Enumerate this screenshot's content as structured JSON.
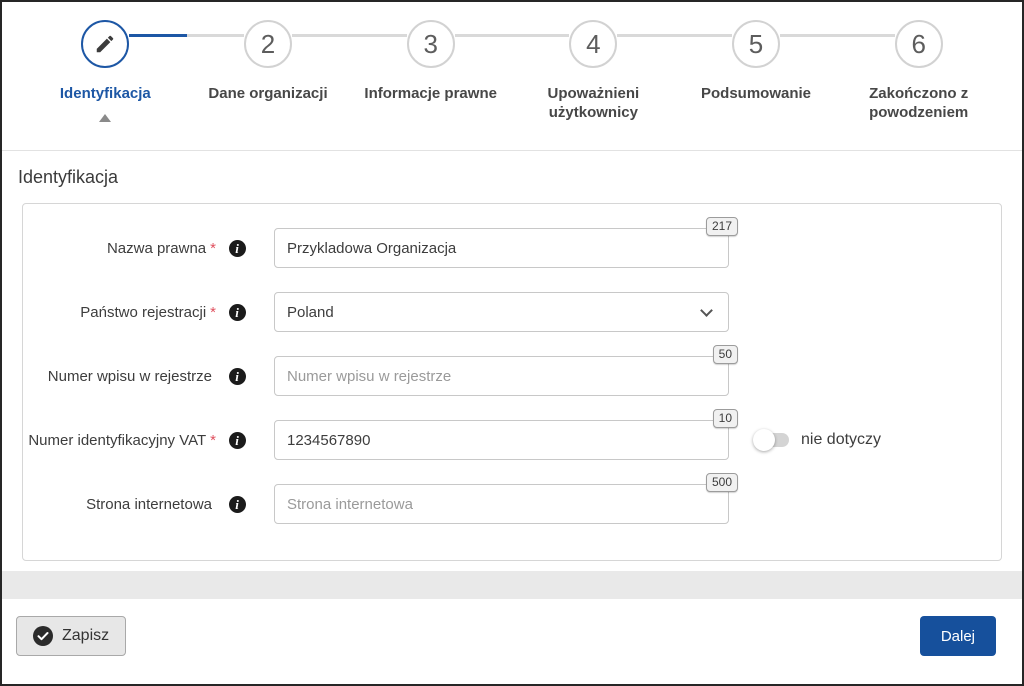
{
  "stepper": {
    "steps": [
      {
        "label": "Identyfikacja",
        "state": "active",
        "icon": "pencil-icon"
      },
      {
        "number": "2",
        "label": "Dane organizacji",
        "state": "upcoming"
      },
      {
        "number": "3",
        "label": "Informacje prawne",
        "state": "upcoming"
      },
      {
        "number": "4",
        "label": "Upoważnieni użytkownicy",
        "state": "upcoming"
      },
      {
        "number": "5",
        "label": "Podsumowanie",
        "state": "upcoming"
      },
      {
        "number": "6",
        "label": "Zakończono z powodzeniem",
        "state": "upcoming"
      }
    ]
  },
  "section": {
    "title": "Identyfikacja"
  },
  "form": {
    "fields": [
      {
        "label": "Nazwa prawna",
        "star": "*",
        "value": "Przykladowa Organizacja",
        "counter": "217"
      },
      {
        "label": "Państwo rejestracji",
        "star": "*",
        "type": "select",
        "value": "Poland"
      },
      {
        "label": "Numer wpisu w rejestrze",
        "value": "",
        "placeholder": "Numer wpisu w rejestrze",
        "counter": "50"
      },
      {
        "label": "Numer identyfikacyjny VAT",
        "star": "*",
        "value": "1234567890",
        "counter": "10",
        "toggle": {
          "label": "nie dotyczy",
          "state": "off"
        }
      },
      {
        "label": "Strona internetowa",
        "value": "",
        "placeholder": "Strona internetowa",
        "counter": "500"
      }
    ]
  },
  "footer": {
    "save_label": "Zapisz",
    "next_label": "Dalej"
  },
  "colors": {
    "accent_blue": "#1d57a5",
    "button_blue": "#16509c",
    "required_red": "#e0505e"
  }
}
